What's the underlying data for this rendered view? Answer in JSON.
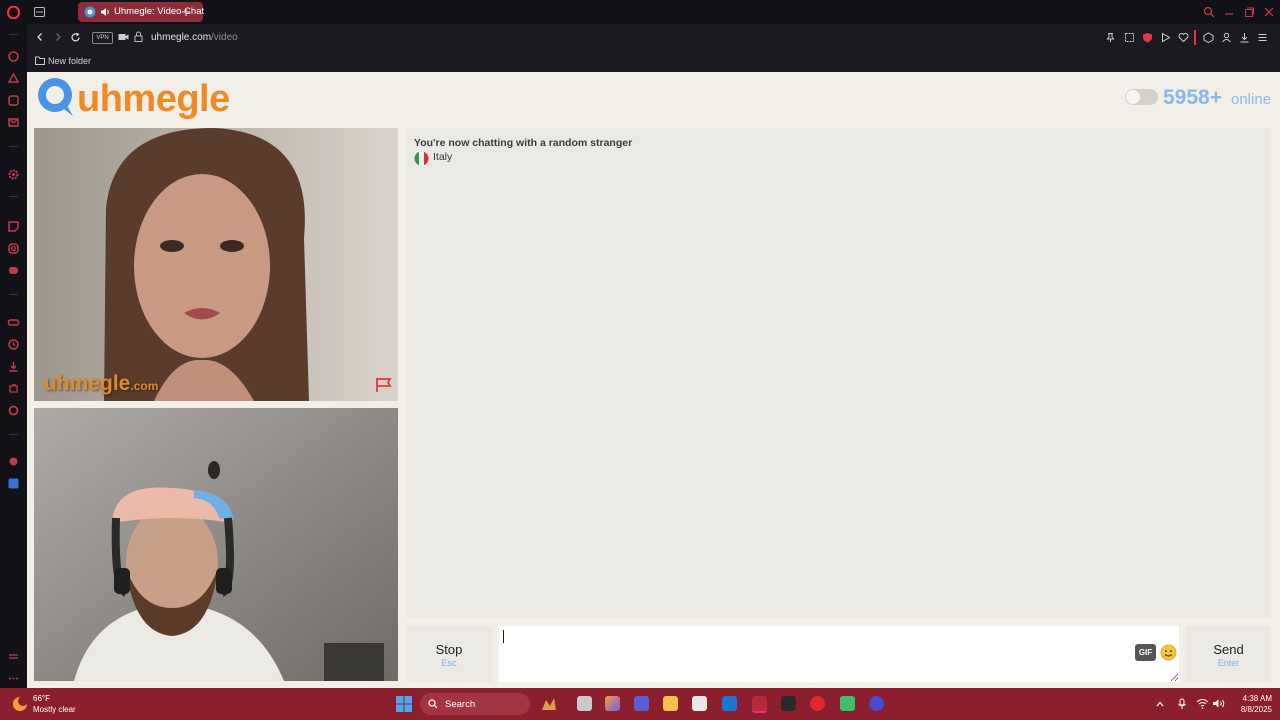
{
  "browser": {
    "tab_title": "Uhmegle: Video Chat",
    "url_host": "uhmegle.com",
    "url_path": "/video",
    "vpn_label": "VPN",
    "bookmark_folder": "New folder"
  },
  "site": {
    "logo_text": "uhmegle",
    "online_count": "5958+",
    "online_label": "online",
    "video_watermark": "uhmegle",
    "video_watermark_suffix": ".com"
  },
  "chat": {
    "status_message": "You're now chatting with a random stranger",
    "stranger_country": "Italy",
    "input_value": "",
    "stop_label": "Stop",
    "stop_hint": "Esc",
    "send_label": "Send",
    "send_hint": "Enter",
    "gif_label": "GIF"
  },
  "taskbar": {
    "weather_temp": "66°F",
    "weather_desc": "Mostly clear",
    "search_label": "Search",
    "time": "4:38 AM",
    "date": "8/8/2025"
  },
  "colors": {
    "browser_accent": "#8c2d3a",
    "taskbar": "#8b1f2d",
    "logo_orange": "#f08a24",
    "online_blue": "#8cb8e8"
  }
}
